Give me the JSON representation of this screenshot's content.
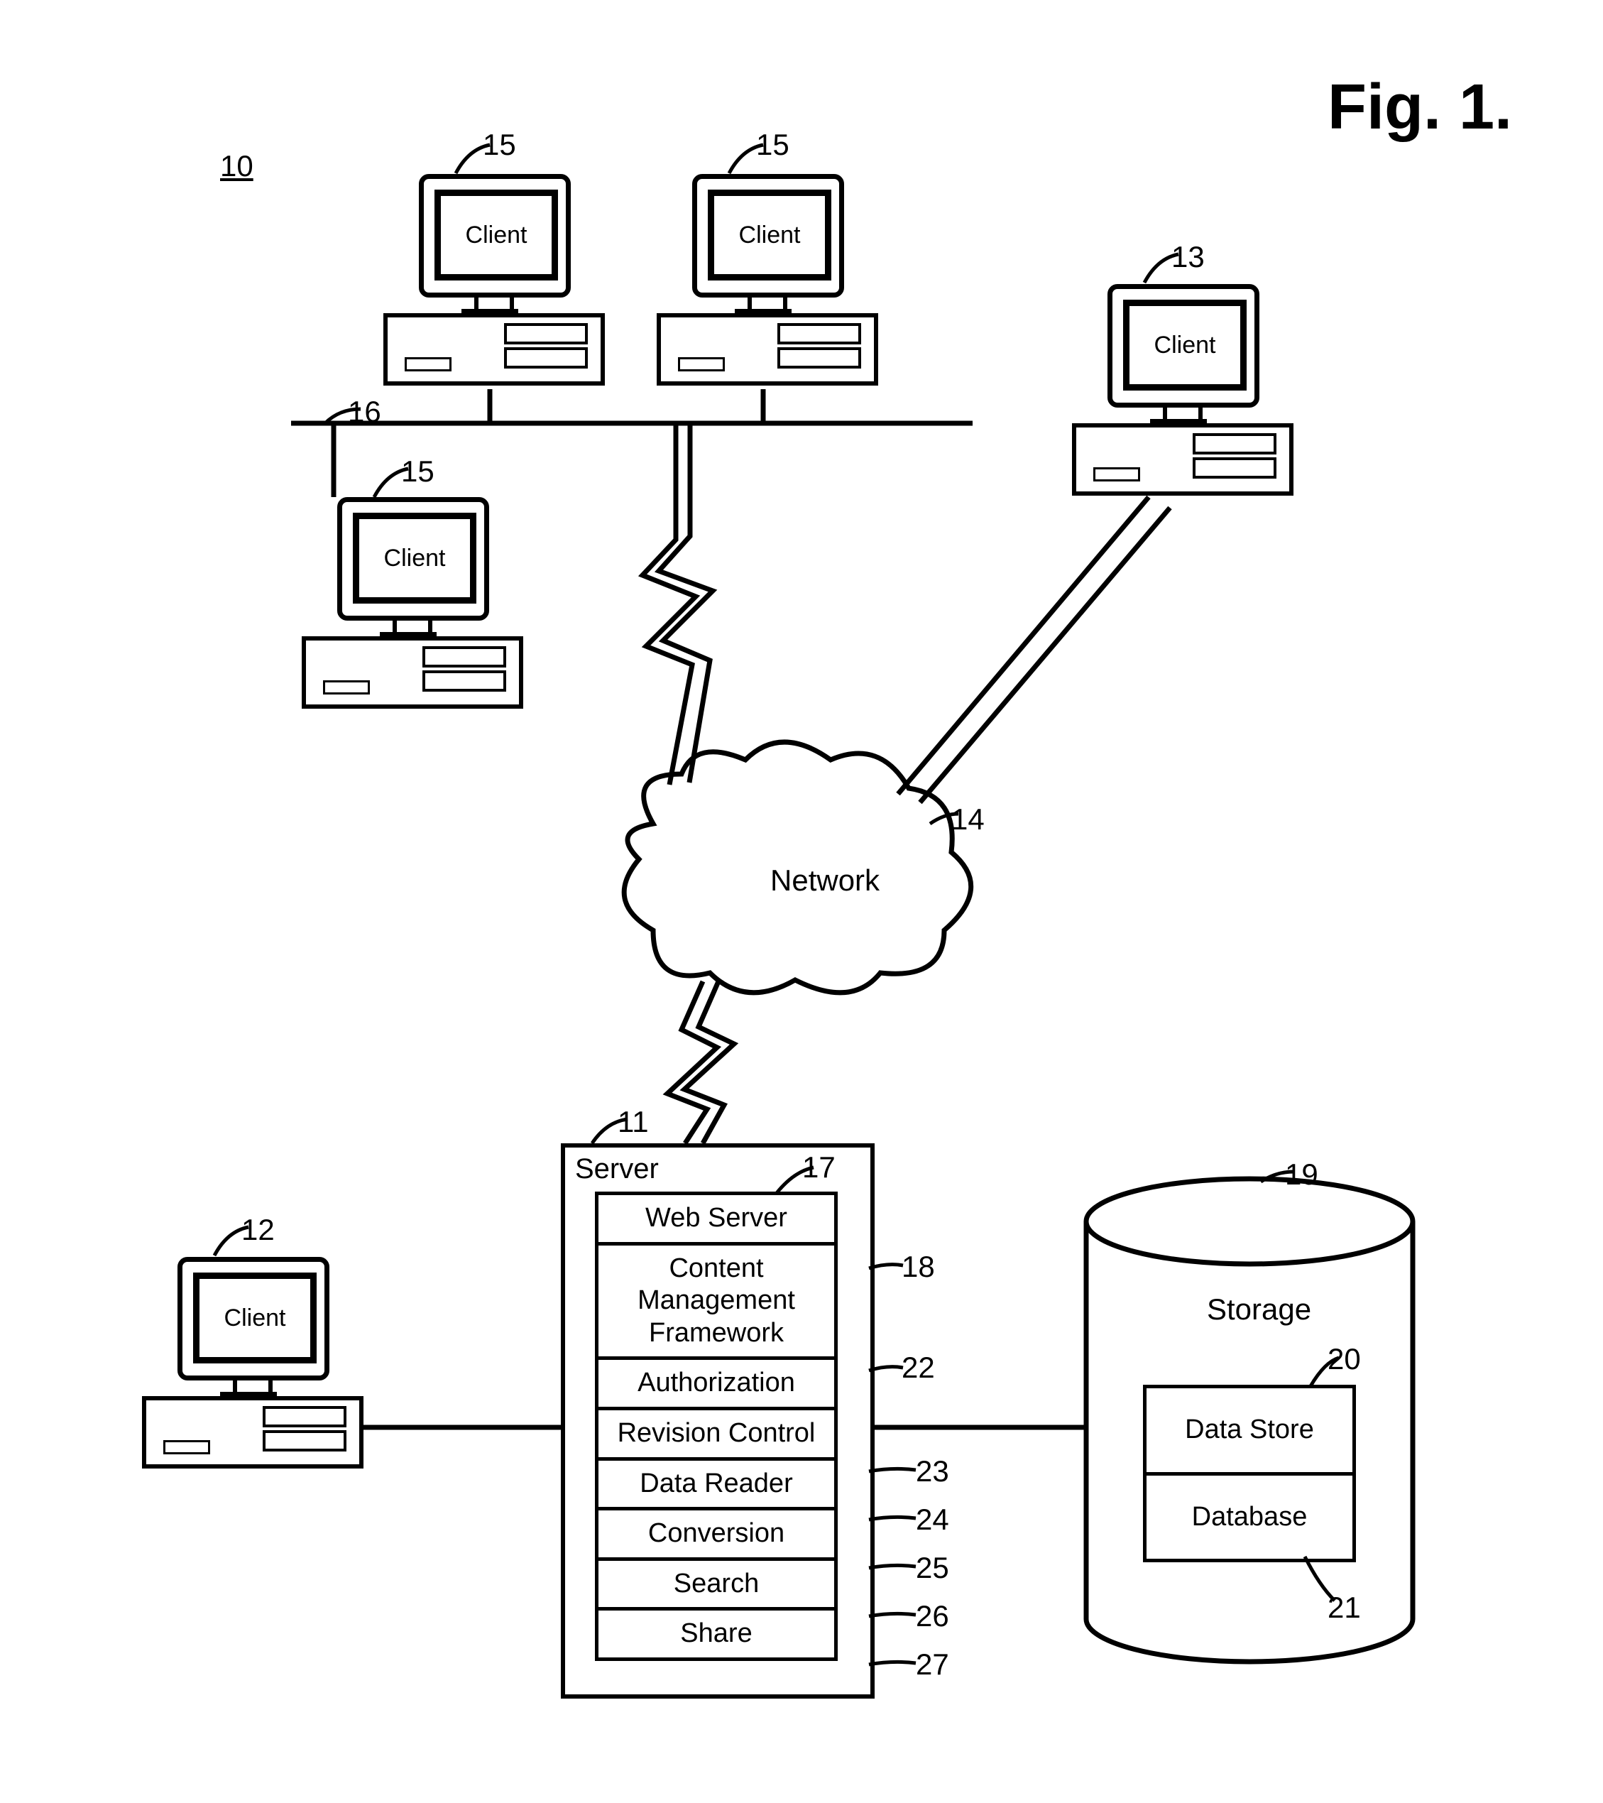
{
  "figure": {
    "title": "Fig. 1."
  },
  "refs": {
    "system": "10",
    "server": "11",
    "client_local": "12",
    "client_remote": "13",
    "network": "14",
    "client_lan_a": "15",
    "client_lan_b": "15",
    "client_lan_c": "15",
    "lan_bar": "16",
    "web_server": "17",
    "cmf": "18",
    "storage": "19",
    "data_store": "20",
    "database": "21",
    "authorization": "22",
    "revision": "23",
    "data_reader": "24",
    "conversion": "25",
    "search": "26",
    "share": "27"
  },
  "labels": {
    "client": "Client",
    "network": "Network",
    "server": "Server",
    "storage": "Storage"
  },
  "server_items": {
    "web_server": "Web Server",
    "cmf": "Content\nManagement\nFramework",
    "authorization": "Authorization",
    "revision": "Revision Control",
    "data_reader": "Data Reader",
    "conversion": "Conversion",
    "search": "Search",
    "share": "Share"
  },
  "storage_items": {
    "data_store": "Data Store",
    "database": "Database"
  }
}
